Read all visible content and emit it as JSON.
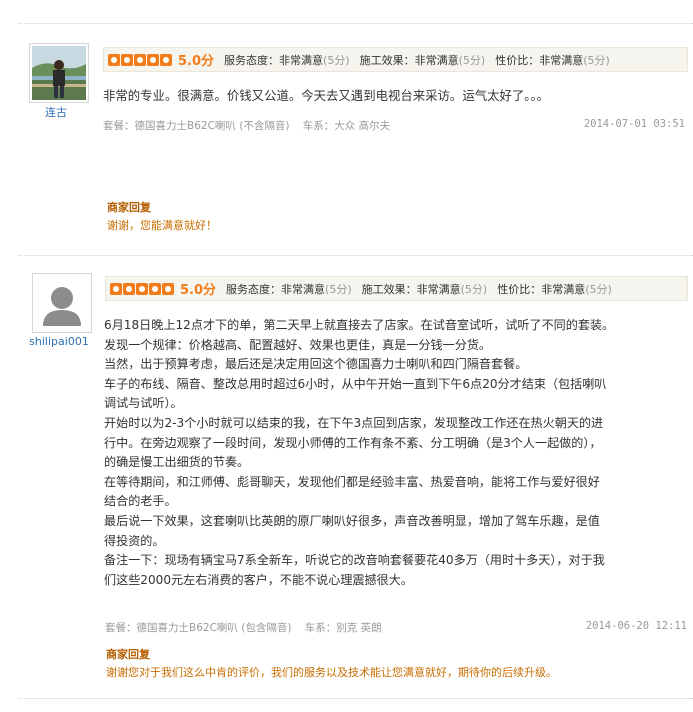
{
  "reviews": [
    {
      "user": "连古",
      "score": "5.0分",
      "metrics": [
        {
          "label": "服务态度：非常满意",
          "sub": "(5分)"
        },
        {
          "label": "施工效果：非常满意",
          "sub": "(5分)"
        },
        {
          "label": "性价比：非常满意",
          "sub": "(5分)"
        }
      ],
      "lines": [
        "非常的专业。很满意。价钱又公道。今天去又遇到电视台来采访。运气太好了。。。"
      ],
      "package": "套餐：德国喜力士B62C喇叭 (不含隔音)",
      "car": "车系：大众 高尔夫",
      "date": "2014-07-01 03:51",
      "reply_title": "商家回复",
      "reply_text": "谢谢，您能满意就好！"
    },
    {
      "user": "shilipai001",
      "score": "5.0分",
      "metrics": [
        {
          "label": "服务态度：非常满意",
          "sub": "(5分)"
        },
        {
          "label": "施工效果：非常满意",
          "sub": "(5分)"
        },
        {
          "label": "性价比：非常满意",
          "sub": "(5分)"
        }
      ],
      "lines": [
        "6月18日晚上12点才下的单，第二天早上就直接去了店家。在试音室试听，试听了不同的套装。",
        "发现一个规律：价格越高、配置越好、效果也更佳，真是一分钱一分货。",
        "当然，出于预算考虑，最后还是决定用回这个德国喜力士喇叭和四门隔音套餐。",
        "车子的布线、隔音、整改总用时超过6小时，从中午开始一直到下午6点20分才结束（包括喇叭",
        "调试与试听）。",
        "开始时以为2-3个小时就可以结束的我，在下午3点回到店家，发现整改工作还在热火朝天的进",
        "行中。在旁边观察了一段时间，发现小师傅的工作有条不紊、分工明确（是3个人一起做的），",
        "的确是慢工出细货的节奏。",
        "在等待期间，和江师傅、彪哥聊天，发现他们都是经验丰富、热爱音响，能将工作与爱好很好",
        "结合的老手。",
        "最后说一下效果，这套喇叭比英朗的原厂喇叭好很多，声音改善明显，增加了驾车乐趣，是值",
        "得投资的。",
        "备注一下：现场有辆宝马7系全新车，听说它的改音响套餐要花40多万（用时十多天），对于我",
        "们这些2000元左右消费的客户，不能不说心理震撼很大。"
      ],
      "package": "套餐：德国喜力士B62C喇叭 (包含隔音)",
      "car": "车系：别克 英朗",
      "date": "2014-06-20 12:11",
      "reply_title": "商家回复",
      "reply_text": "谢谢您对于我们这么中肯的评价，我们的服务以及技术能让您满意就好，期待你的后续升级。"
    }
  ]
}
